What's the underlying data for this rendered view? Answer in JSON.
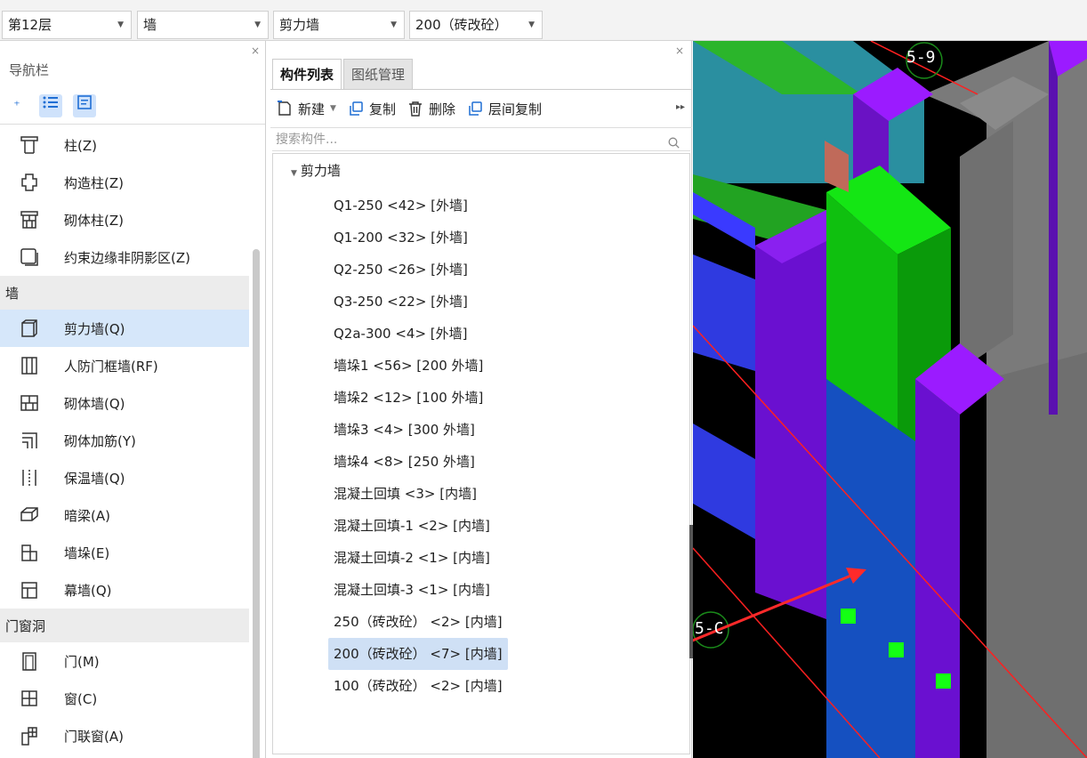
{
  "toolbar": {
    "floor": "第12层",
    "category": "墙",
    "type": "剪力墙",
    "spec": "200（砖改砼）"
  },
  "nav": {
    "title": "导航栏",
    "close": "×",
    "items_top": [
      {
        "label": "柱(Z)",
        "icon": "column-icon"
      },
      {
        "label": "构造柱(Z)",
        "icon": "constructional-column-icon"
      },
      {
        "label": "砌体柱(Z)",
        "icon": "masonry-column-icon"
      },
      {
        "label": "约束边缘非阴影区(Z)",
        "icon": "edge-zone-icon"
      }
    ],
    "group_wall": "墙",
    "items_wall": [
      {
        "label": "剪力墙(Q)",
        "icon": "shear-wall-icon",
        "selected": true
      },
      {
        "label": "人防门框墙(RF)",
        "icon": "civil-defense-wall-icon"
      },
      {
        "label": "砌体墙(Q)",
        "icon": "masonry-wall-icon"
      },
      {
        "label": "砌体加筋(Y)",
        "icon": "masonry-rebar-icon"
      },
      {
        "label": "保温墙(Q)",
        "icon": "insulation-wall-icon"
      },
      {
        "label": "暗梁(A)",
        "icon": "hidden-beam-icon"
      },
      {
        "label": "墙垛(E)",
        "icon": "wall-pier-icon"
      },
      {
        "label": "幕墙(Q)",
        "icon": "curtain-wall-icon"
      }
    ],
    "group_openings": "门窗洞",
    "items_openings": [
      {
        "label": "门(M)",
        "icon": "door-icon"
      },
      {
        "label": "窗(C)",
        "icon": "window-icon"
      },
      {
        "label": "门联窗(A)",
        "icon": "door-window-icon"
      }
    ]
  },
  "components": {
    "close": "×",
    "tabs": [
      "构件列表",
      "图纸管理"
    ],
    "actions": {
      "new": "新建",
      "copy": "复制",
      "delete": "删除",
      "floor_copy": "层间复制"
    },
    "search_placeholder": "搜索构件...",
    "tree_root": "剪力墙",
    "items": [
      "Q1-250 <42> [外墙]",
      "Q1-200 <32> [外墙]",
      "Q2-250 <26> [外墙]",
      "Q3-250 <22> [外墙]",
      "Q2a-300 <4> [外墙]",
      "墙垛1 <56> [200 外墙]",
      "墙垛2 <12> [100 外墙]",
      "墙垛3 <4> [300 外墙]",
      "墙垛4 <8> [250 外墙]",
      "混凝土回填 <3> [内墙]",
      "混凝土回填-1 <2> [内墙]",
      "混凝土回填-2 <1> [内墙]",
      "混凝土回填-3 <1> [内墙]",
      "250（砖改砼） <2> [内墙]",
      "200（砖改砼） <7> [内墙]",
      "100（砖改砼） <2> [内墙]"
    ],
    "selected_index": 14
  },
  "viewport": {
    "grid_label_top": "5-9",
    "grid_label_left": "5-C"
  }
}
